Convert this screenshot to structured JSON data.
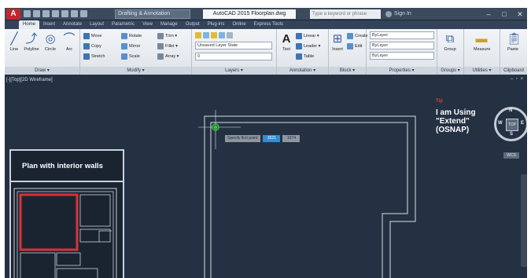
{
  "titlebar": {
    "app_logo": "A",
    "workspace": "Drafting & Annotation",
    "doc_title": "AutoCAD 2015   Floorplan.dwg",
    "search_placeholder": "Type a keyword or phrase",
    "signin": "Sign In",
    "minimize": "–",
    "maximize": "□",
    "close": "✕"
  },
  "tabs": [
    "Home",
    "Insert",
    "Annotate",
    "Layout",
    "Parametric",
    "View",
    "Manage",
    "Output",
    "Plug-ins",
    "Online",
    "Express Tools"
  ],
  "ribbon": {
    "draw": {
      "title": "Draw ▾",
      "line": "Line",
      "polyline": "Polyline",
      "circle": "Circle",
      "arc": "Arc"
    },
    "modify": {
      "title": "Modify ▾",
      "move": "Move",
      "rotate": "Rotate",
      "trim": "Trim ▾",
      "copy": "Copy",
      "mirror": "Mirror",
      "fillet": "Fillet ▾",
      "stretch": "Stretch",
      "scale": "Scale",
      "array": "Array ▾"
    },
    "layers": {
      "title": "Layers ▾",
      "layer_state": "Unsaved Layer State",
      "current_layer": "0"
    },
    "annotation": {
      "title": "Annotation ▾",
      "text": "Text",
      "linear": "Linear ▾",
      "leader": "Leader ▾",
      "table": "Table"
    },
    "block": {
      "title": "Block ▾",
      "insert": "Insert",
      "create": "Create",
      "edit": "Edit"
    },
    "properties": {
      "title": "Properties ▾",
      "color": "ByLayer",
      "linetype": "ByLayer",
      "lineweight": "ByLayer"
    },
    "groups": {
      "title": "Groups ▾",
      "group": "Group"
    },
    "utilities": {
      "title": "Utilities ▾",
      "measure": "Measure"
    },
    "clipboard": {
      "title": "Clipboard",
      "paste": "Paste"
    }
  },
  "canvas": {
    "viewport_label": "[-][Top][2D Wireframe]",
    "close_controls": "– ▫ ×",
    "tooltip_prompt": "Specify first point:",
    "tooltip_value_1": "3521",
    "tooltip_value_2": "1074"
  },
  "inset": {
    "title": "Plan with interior walls"
  },
  "annotation_text": {
    "kicker": "Tip",
    "line1": "I am Using",
    "line2": "\"Extend\"",
    "line3": "(OSNAP)"
  },
  "viewcube": {
    "face": "TOP",
    "north": "N",
    "south": "S",
    "east": "E",
    "west": "W",
    "wcs": "WCS"
  },
  "colors": {
    "canvas": "#243142",
    "wall_lines": "#d9dee4",
    "highlight_room": "#d6333a",
    "snap_marker": "#36c23a",
    "annotation_kicker": "#e53a3a"
  }
}
